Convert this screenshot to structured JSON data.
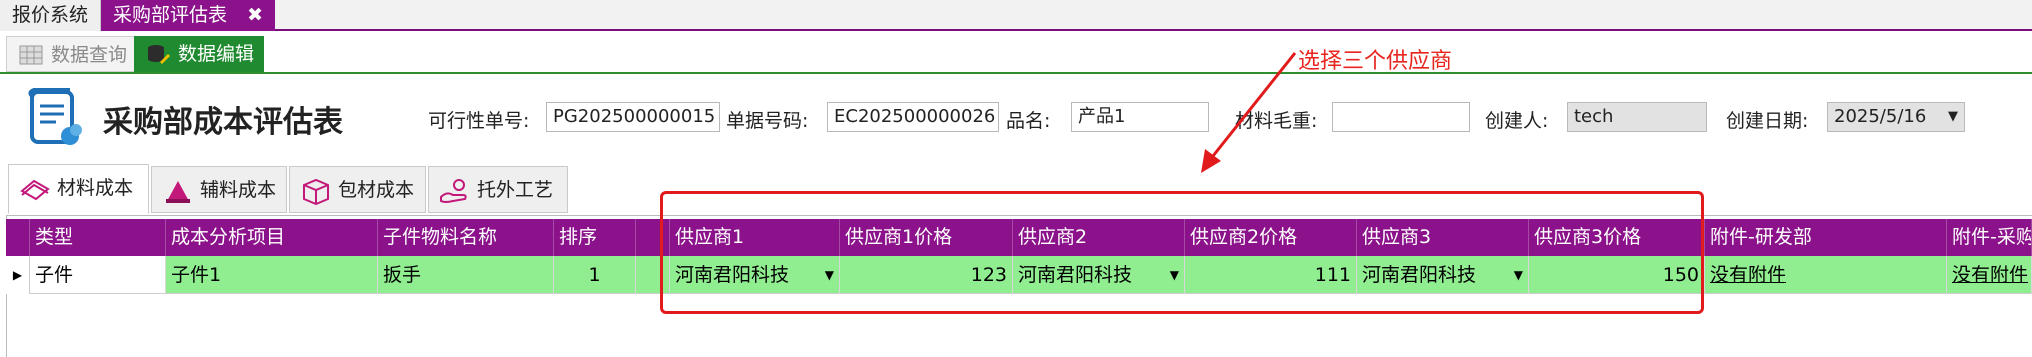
{
  "doc_tabs": [
    {
      "label": "报价系统",
      "active": false
    },
    {
      "label": "采购部评估表",
      "active": true,
      "close": "✖"
    }
  ],
  "mode_tabs": [
    {
      "label": "数据查询",
      "active": false,
      "icon": "table-icon"
    },
    {
      "label": "数据编辑",
      "active": true,
      "icon": "database-edit-icon"
    }
  ],
  "form": {
    "title": "采购部成本评估表",
    "feasibility_no_label": "可行性单号:",
    "feasibility_no": "PG202500000015",
    "doc_no_label": "单据号码:",
    "doc_no": "EC202500000026",
    "product_label": "品名:",
    "product": "产品1",
    "gross_weight_label": "材料毛重:",
    "gross_weight": "",
    "creator_label": "创建人:",
    "creator": "tech",
    "created_date_label": "创建日期:",
    "created_date": "2025/5/16"
  },
  "cost_tabs": [
    {
      "label": "材料成本",
      "active": true
    },
    {
      "label": "辅料成本",
      "active": false
    },
    {
      "label": "包材成本",
      "active": false
    },
    {
      "label": "托外工艺",
      "active": false
    }
  ],
  "grid": {
    "columns": [
      "类型",
      "成本分析项目",
      "子件物料名称",
      "排序",
      "",
      "供应商1",
      "供应商1价格",
      "供应商2",
      "供应商2价格",
      "供应商3",
      "供应商3价格",
      "附件-研发部",
      "附件-采购部"
    ],
    "rows": [
      {
        "type": "子件",
        "item": "子件1",
        "material": "扳手",
        "order": "1",
        "supplier1": "河南君阳科技",
        "price1": "123",
        "supplier2": "河南君阳科技",
        "price2": "111",
        "supplier3": "河南君阳科技",
        "price3": "150",
        "attach_rd": "没有附件",
        "attach_purchase": "没有附件"
      }
    ]
  },
  "annotation": {
    "text": "选择三个供应商"
  },
  "colors": {
    "accent": "#8b128b",
    "edit_tab": "#1f8a2f",
    "row_highlight": "#90ee90",
    "annotation": "#e11b1b"
  }
}
